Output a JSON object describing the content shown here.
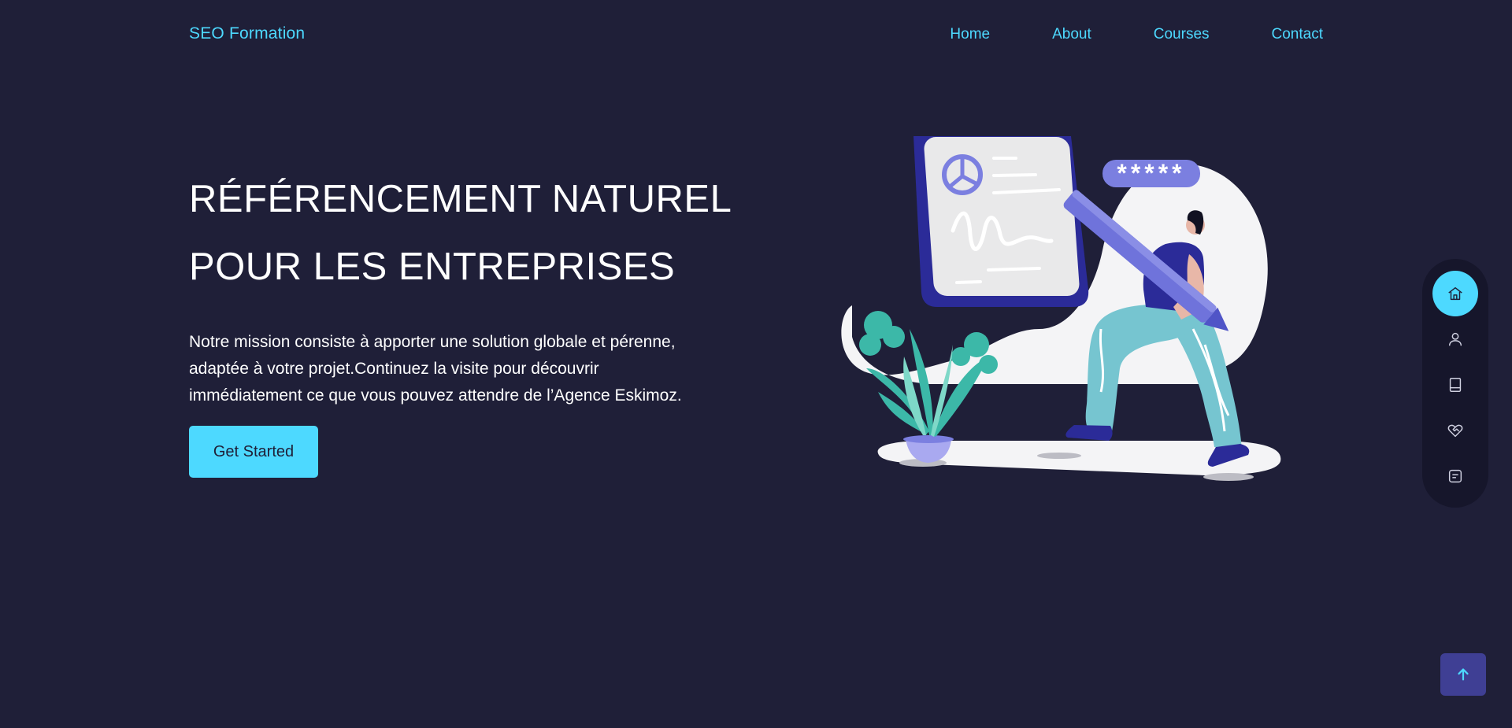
{
  "header": {
    "logo": "SEO Formation",
    "nav": [
      "Home",
      "About",
      "Courses",
      "Contact"
    ]
  },
  "hero": {
    "title_line1": "RÉFÉRENCEMENT NATUREL",
    "title_line2": "POUR LES ENTREPRISES",
    "description_line1": "Notre mission consiste à apporter une solution globale et pérenne,",
    "description_line2": "adaptée à votre projet.Continuez la visite pour découvrir",
    "description_line3": "immédiatement ce que vous pouvez attendre de l’Agence Eskimoz.",
    "cta_label": "Get Started"
  },
  "illustration": {
    "password_mask": "*****"
  },
  "side_nav": {
    "items": [
      {
        "icon": "home-icon",
        "active": true
      },
      {
        "icon": "user-icon",
        "active": false
      },
      {
        "icon": "book-icon",
        "active": false
      },
      {
        "icon": "handshake-icon",
        "active": false
      },
      {
        "icon": "message-icon",
        "active": false
      }
    ]
  },
  "scroll_top": {
    "icon": "arrow-up-icon"
  },
  "colors": {
    "background": "#1f1f38",
    "accent": "#4dd9ff",
    "side_nav_bg": "#16162b",
    "scroll_top_bg": "#3f3f94"
  }
}
